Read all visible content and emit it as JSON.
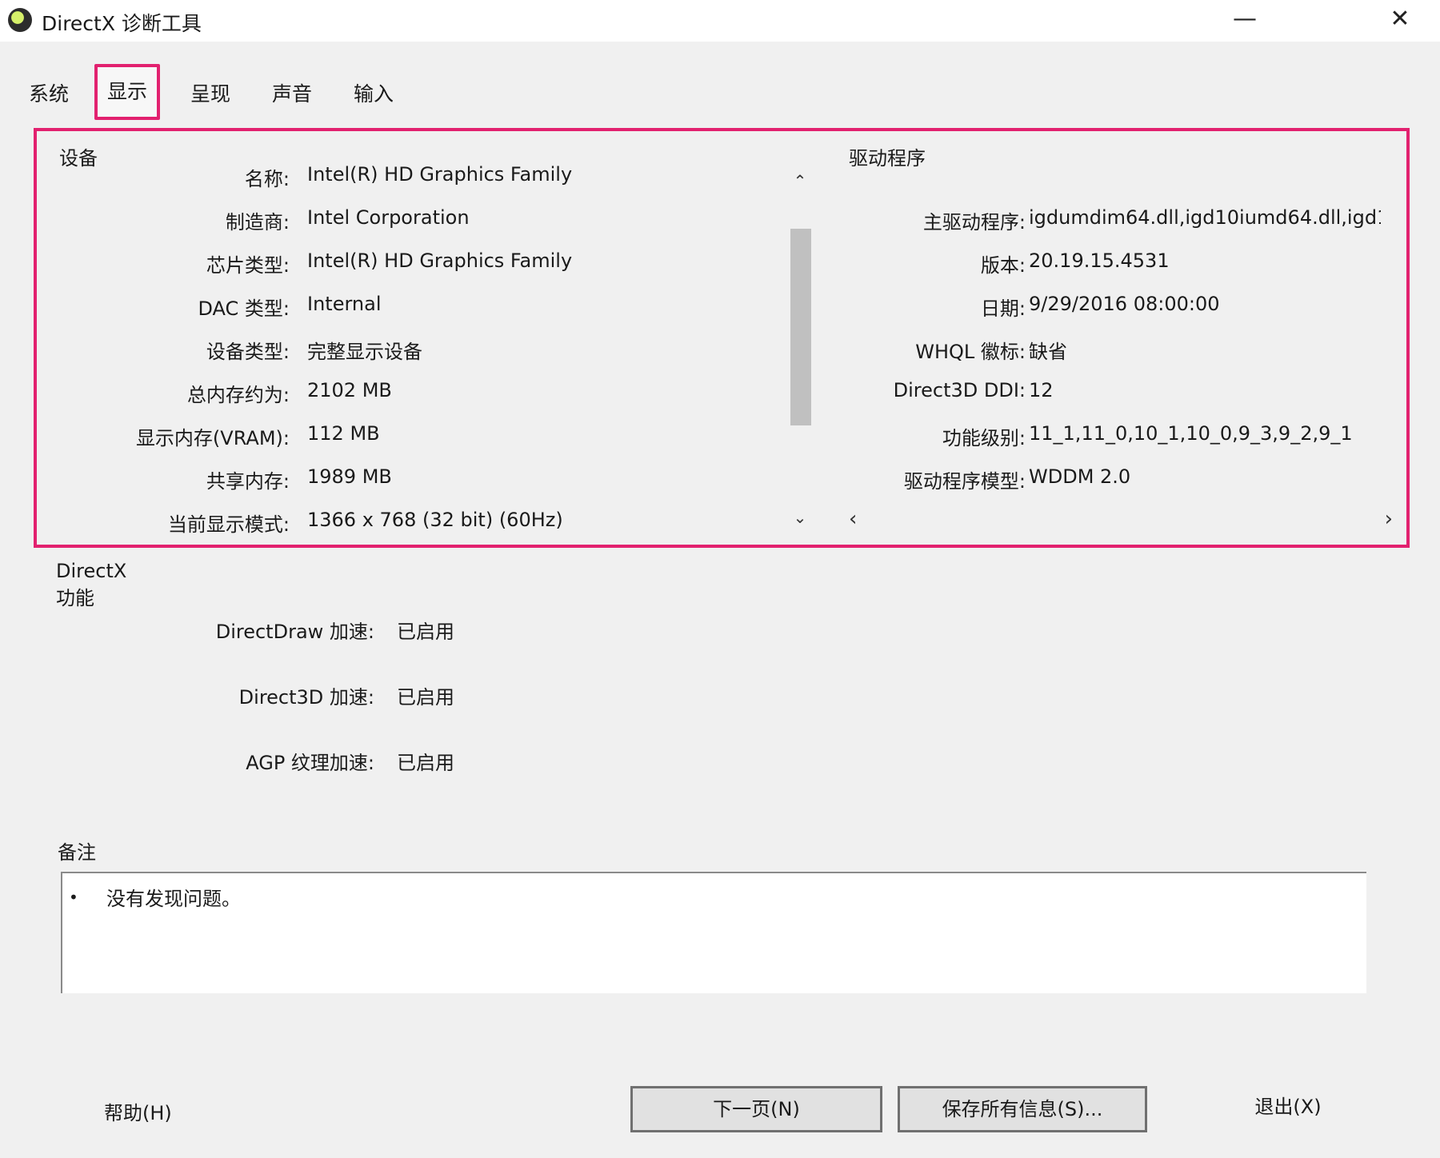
{
  "window": {
    "title": "DirectX 诊断工具",
    "minimize": "—",
    "close": "✕"
  },
  "tabs": [
    {
      "label": "系统",
      "active": false
    },
    {
      "label": "显示",
      "active": true
    },
    {
      "label": "呈现",
      "active": false
    },
    {
      "label": "声音",
      "active": false
    },
    {
      "label": "输入",
      "active": false
    }
  ],
  "device": {
    "heading": "设备",
    "rows": [
      {
        "label": "名称:",
        "value": "Intel(R) HD Graphics Family"
      },
      {
        "label": "制造商:",
        "value": "Intel Corporation"
      },
      {
        "label": "芯片类型:",
        "value": "Intel(R) HD Graphics Family"
      },
      {
        "label": "DAC 类型:",
        "value": "Internal"
      },
      {
        "label": "设备类型:",
        "value": "完整显示设备"
      },
      {
        "label": "总内存约为:",
        "value": "2102 MB"
      },
      {
        "label": "显示内存(VRAM):",
        "value": "112 MB"
      },
      {
        "label": "共享内存:",
        "value": "1989 MB"
      },
      {
        "label": "当前显示模式:",
        "value": "1366 x 768 (32 bit) (60Hz)"
      }
    ]
  },
  "driver": {
    "heading": "驱动程序",
    "rows": [
      {
        "label": "主驱动程序:",
        "value": "igdumdim64.dll,igd10iumd64.dll,igd1"
      },
      {
        "label": "版本:",
        "value": "20.19.15.4531"
      },
      {
        "label": "日期:",
        "value": "9/29/2016 08:00:00"
      },
      {
        "label": "WHQL 徽标:",
        "value": "缺省"
      },
      {
        "label": "Direct3D DDI:",
        "value": "12"
      },
      {
        "label": "功能级别:",
        "value": "11_1,11_0,10_1,10_0,9_3,9_2,9_1"
      },
      {
        "label": "驱动程序模型:",
        "value": "WDDM 2.0"
      }
    ]
  },
  "scroll": {
    "up": "⌃",
    "down": "⌄",
    "left": "‹",
    "right": "›"
  },
  "directx": {
    "heading": "DirectX 功能",
    "rows": [
      {
        "label": "DirectDraw 加速:",
        "value": "已启用"
      },
      {
        "label": "Direct3D 加速:",
        "value": "已启用"
      },
      {
        "label": "AGP 纹理加速:",
        "value": "已启用"
      }
    ]
  },
  "notes": {
    "heading": "备注",
    "bullet": "•",
    "items": [
      "没有发现问题。"
    ]
  },
  "footer": {
    "help": "帮助(H)",
    "next": "下一页(N)",
    "save": "保存所有信息(S)...",
    "exit": "退出(X)"
  },
  "colors": {
    "highlight": "#e2216f",
    "background": "#f0f0f0"
  }
}
